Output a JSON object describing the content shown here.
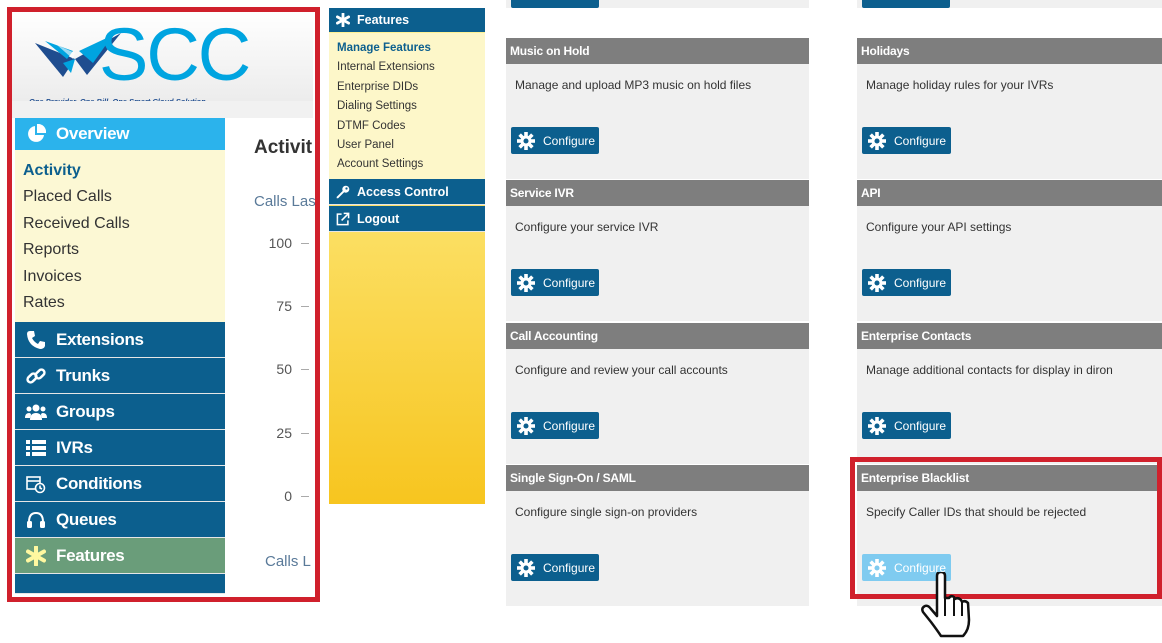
{
  "logo": {
    "text": "SCC",
    "tagline": "One Provider, One Bill, One Smart Cloud Solution."
  },
  "sidenav": {
    "overview": {
      "label": "Overview",
      "icon": "pie-chart-icon"
    },
    "overview_items": [
      "Activity",
      "Placed Calls",
      "Received Calls",
      "Reports",
      "Invoices",
      "Rates"
    ],
    "items": [
      {
        "label": "Extensions",
        "icon": "phone-icon"
      },
      {
        "label": "Trunks",
        "icon": "link-icon"
      },
      {
        "label": "Groups",
        "icon": "users-icon"
      },
      {
        "label": "IVRs",
        "icon": "list-icon"
      },
      {
        "label": "Conditions",
        "icon": "calendar-clock-icon"
      },
      {
        "label": "Queues",
        "icon": "headset-icon"
      },
      {
        "label": "Features",
        "icon": "asterisk-icon"
      }
    ]
  },
  "activity": {
    "title": "Activit",
    "calls_label_1": "Calls Las",
    "calls_label_2": "Calls L",
    "y_ticks": [
      "100",
      "75",
      "50",
      "25",
      "0"
    ]
  },
  "features_menu": {
    "title": "Features",
    "items": [
      "Manage Features",
      "Internal Extensions",
      "Enterprise DIDs",
      "Dialing Settings",
      "DTMF Codes",
      "User Panel",
      "Account Settings"
    ],
    "access_control": "Access Control",
    "logout": "Logout"
  },
  "cards": [
    {
      "title": "Music on Hold",
      "desc": "Manage and upload MP3 music on hold files",
      "button": "Configure"
    },
    {
      "title": "Holidays",
      "desc": "Manage holiday rules for your IVRs",
      "button": "Configure"
    },
    {
      "title": "Service IVR",
      "desc": "Configure your service IVR",
      "button": "Configure"
    },
    {
      "title": "API",
      "desc": "Configure your API settings",
      "button": "Configure"
    },
    {
      "title": "Call Accounting",
      "desc": "Configure and review your call accounts",
      "button": "Configure"
    },
    {
      "title": "Enterprise Contacts",
      "desc": "Manage additional contacts for display in diron",
      "button": "Configure"
    },
    {
      "title": "Single Sign-On / SAML",
      "desc": "Configure single sign-on providers",
      "button": "Configure"
    },
    {
      "title": "Enterprise Blacklist",
      "desc": "Specify Caller IDs that should be rejected",
      "button": "Configure"
    }
  ],
  "colors": {
    "nav_dark": "#0c5f8e",
    "nav_active": "#2bb3ec",
    "highlight_red": "#d0202c",
    "button_hover": "#7fcbf0"
  }
}
